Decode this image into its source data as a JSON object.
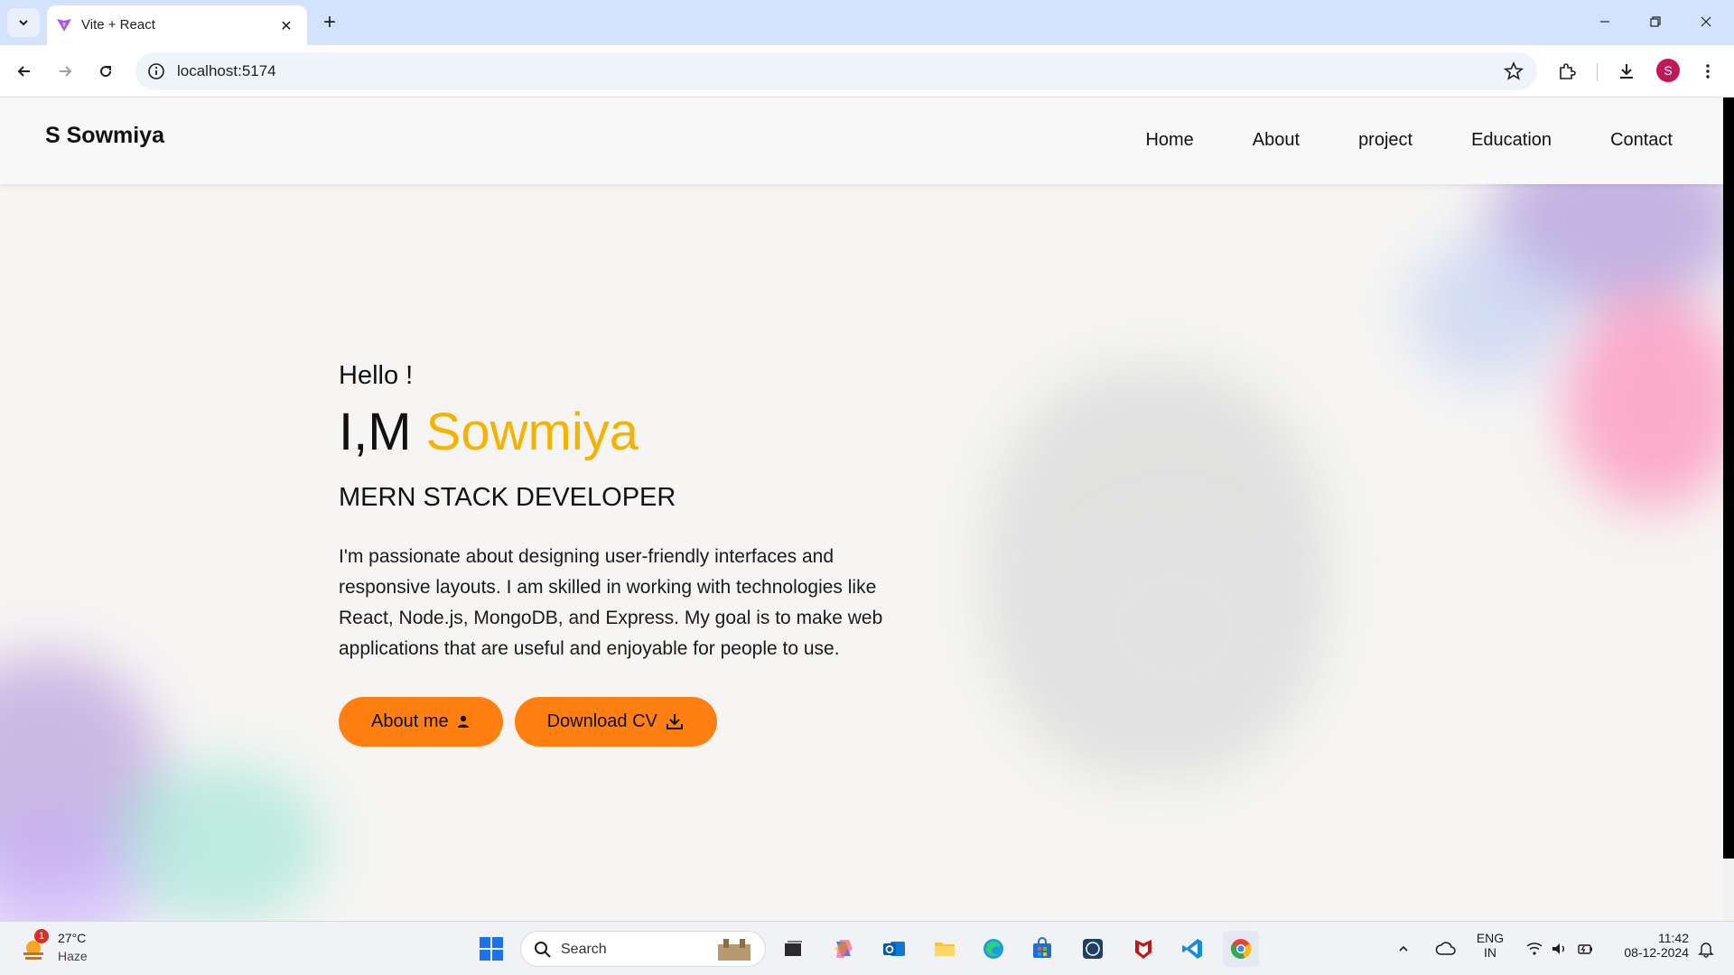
{
  "browser": {
    "tab_title": "Vite + React",
    "url": "localhost:5174",
    "profile_initial": "S"
  },
  "site": {
    "brand": "S Sowmiya",
    "nav": [
      "Home",
      "About",
      "project",
      "Education",
      "Contact"
    ]
  },
  "hero": {
    "greeting": "Hello !",
    "headline_prefix": "I,M",
    "headline_name": "Sowmiya",
    "role": "MERN STACK DEVELOPER",
    "bio": "I'm passionate about designing user-friendly interfaces and responsive layouts. I am skilled in working with technologies like React, Node.js, MongoDB, and Express. My goal is to make web applications that are useful and enjoyable for people to use.",
    "buttons": {
      "about": "About me",
      "download": "Download CV"
    }
  },
  "colors": {
    "accent_name": "#f5b300",
    "button": "#ff7f11"
  },
  "taskbar": {
    "weather_temp": "27°C",
    "weather_condition": "Haze",
    "weather_badge": "1",
    "search_label": "Search",
    "language_line1": "ENG",
    "language_line2": "IN",
    "time": "11:42",
    "date": "08-12-2024"
  }
}
